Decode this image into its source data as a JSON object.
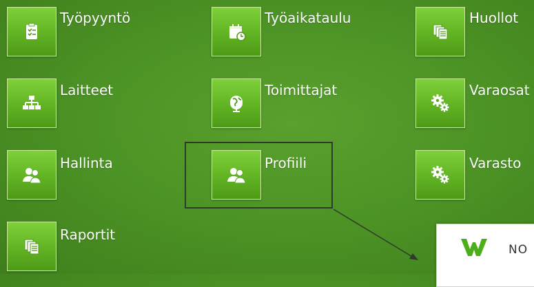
{
  "tiles": [
    {
      "label": "Työpyyntö",
      "icon": "clipboard-icon"
    },
    {
      "label": "Työaikataulu",
      "icon": "calendar-clock-icon"
    },
    {
      "label": "Huollot",
      "icon": "documents-icon"
    },
    {
      "label": "Laitteet",
      "icon": "hierarchy-icon"
    },
    {
      "label": "Toimittajat",
      "icon": "globe-icon"
    },
    {
      "label": "Varaosat",
      "icon": "gears-icon"
    },
    {
      "label": "Hallinta",
      "icon": "users-icon"
    },
    {
      "label": "Profiili",
      "icon": "users-icon"
    },
    {
      "label": "Varasto",
      "icon": "gears-icon"
    },
    {
      "label": "Raportit",
      "icon": "documents-icon"
    }
  ],
  "popup": {
    "brand_text": "NO"
  },
  "colors": {
    "background": "#4d9426",
    "tile": "#6ab82a",
    "tile_border": "#c9ee9a",
    "highlight": "#2e3a2a",
    "logo": "#4caf1a"
  }
}
